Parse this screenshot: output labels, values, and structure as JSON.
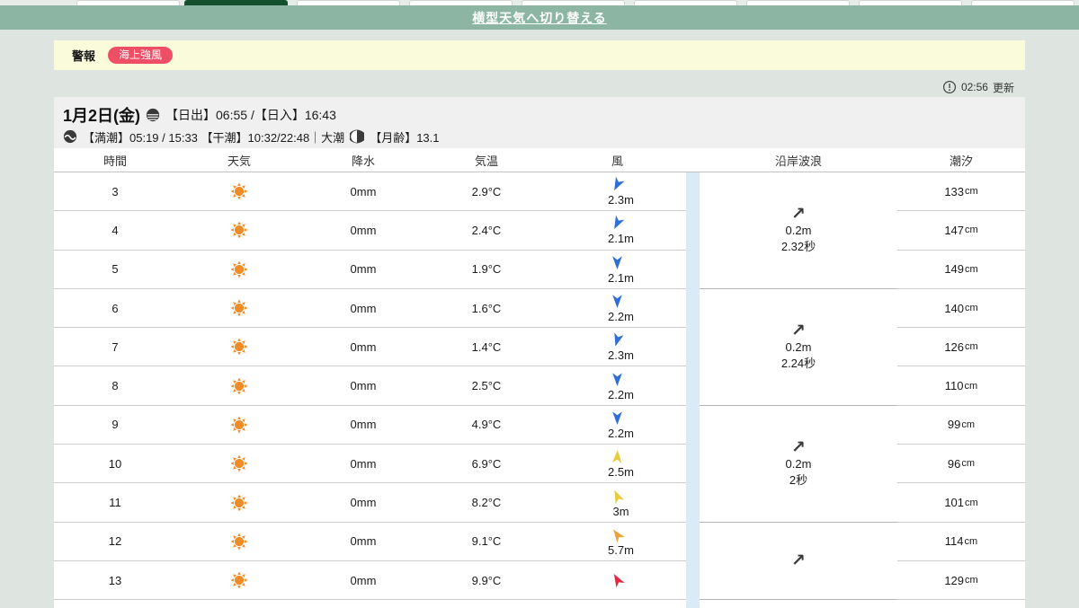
{
  "tabs": {
    "count": 9,
    "selected_index": 1,
    "selected_color": "#15502e"
  },
  "banner": {
    "link": "横型天気へ切り替える",
    "bg": "#8cb5a4"
  },
  "warning": {
    "label": "警報",
    "badge": "海上強風",
    "badge_color": "#ee4f66"
  },
  "update": {
    "time": "02:56",
    "suffix": "更新"
  },
  "date_header": {
    "date": "1月2日(金)",
    "sunrise_icon": "sunrise-icon",
    "sun_times": "【日出】06:55 /【日入】16:43",
    "tide_icon": "tide-wave-icon",
    "tide_times": "【満潮】05:19 / 15:33 【干潮】10:32/22:48｜大潮",
    "moon_icon": "moon-icon",
    "moon_age": "【月齢】13.1"
  },
  "table": {
    "headers": [
      "時間",
      "天気",
      "降水",
      "気温",
      "風",
      "沿岸波浪",
      "潮汐"
    ],
    "tide_unit": "cm",
    "rows": [
      {
        "hour": "3",
        "weather": "sunny",
        "precip": "0mm",
        "temp": "2.9°C",
        "wind_speed": "2.3m",
        "wind_deg": 207,
        "wind_color": "#2e6ed6",
        "tide": "133"
      },
      {
        "hour": "4",
        "weather": "sunny",
        "precip": "0mm",
        "temp": "2.4°C",
        "wind_speed": "2.1m",
        "wind_deg": 207,
        "wind_color": "#2e6ed6",
        "tide": "147"
      },
      {
        "hour": "5",
        "weather": "sunny",
        "precip": "0mm",
        "temp": "1.9°C",
        "wind_speed": "2.1m",
        "wind_deg": 180,
        "wind_color": "#2e6ed6",
        "tide": "149"
      },
      {
        "hour": "6",
        "weather": "sunny",
        "precip": "0mm",
        "temp": "1.6°C",
        "wind_speed": "2.2m",
        "wind_deg": 180,
        "wind_color": "#2e6ed6",
        "tide": "140"
      },
      {
        "hour": "7",
        "weather": "sunny",
        "precip": "0mm",
        "temp": "1.4°C",
        "wind_speed": "2.3m",
        "wind_deg": 196,
        "wind_color": "#2e6ed6",
        "tide": "126"
      },
      {
        "hour": "8",
        "weather": "sunny",
        "precip": "0mm",
        "temp": "2.5°C",
        "wind_speed": "2.2m",
        "wind_deg": 180,
        "wind_color": "#2e6ed6",
        "tide": "110"
      },
      {
        "hour": "9",
        "weather": "sunny",
        "precip": "0mm",
        "temp": "4.9°C",
        "wind_speed": "2.2m",
        "wind_deg": 180,
        "wind_color": "#2e6ed6",
        "tide": "99"
      },
      {
        "hour": "10",
        "weather": "sunny",
        "precip": "0mm",
        "temp": "6.9°C",
        "wind_speed": "2.5m",
        "wind_deg": 3,
        "wind_color": "#e9cb3f",
        "tide": "96"
      },
      {
        "hour": "11",
        "weather": "sunny",
        "precip": "0mm",
        "temp": "8.2°C",
        "wind_speed": "3m",
        "wind_deg": 336,
        "wind_color": "#e9cb3f",
        "tide": "101"
      },
      {
        "hour": "12",
        "weather": "sunny",
        "precip": "0mm",
        "temp": "9.1°C",
        "wind_speed": "5.7m",
        "wind_deg": 324,
        "wind_color": "#eda13c",
        "tide": "114"
      },
      {
        "hour": "13",
        "weather": "sunny",
        "precip": "0mm",
        "temp": "9.9°C",
        "wind_speed": "",
        "wind_deg": 330,
        "wind_color": "#dd2b44",
        "tide": "129"
      }
    ],
    "wave_groups": [
      {
        "span_rows": 3,
        "arrow": "↗",
        "height": "0.2m",
        "period": "2.32秒"
      },
      {
        "span_rows": 3,
        "arrow": "↗",
        "height": "0.2m",
        "period": "2.24秒"
      },
      {
        "span_rows": 3,
        "arrow": "↗",
        "height": "0.2m",
        "period": "2秒"
      },
      {
        "span_rows": 2,
        "arrow": "↗",
        "height": "",
        "period": ""
      }
    ]
  }
}
